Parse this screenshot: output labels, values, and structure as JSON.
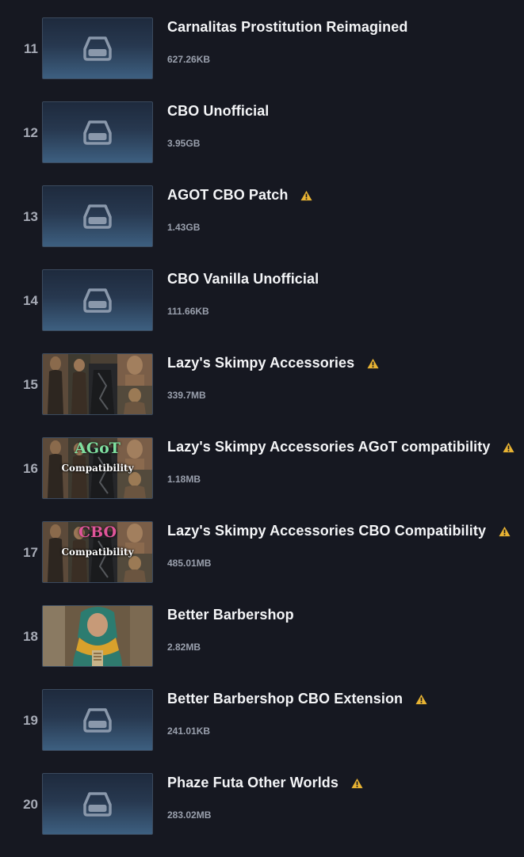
{
  "mods": [
    {
      "index": "11",
      "name": "Carnalitas Prostitution Reimagined",
      "size": "627.26KB",
      "warning": false,
      "thumbnail": "placeholder-drive-icon"
    },
    {
      "index": "12",
      "name": "CBO Unofficial",
      "size": "3.95GB",
      "warning": false,
      "thumbnail": "placeholder-drive-icon"
    },
    {
      "index": "13",
      "name": "AGOT CBO Patch",
      "size": "1.43GB",
      "warning": true,
      "thumbnail": "placeholder-drive-icon"
    },
    {
      "index": "14",
      "name": "CBO Vanilla Unofficial",
      "size": "111.66KB",
      "warning": false,
      "thumbnail": "placeholder-drive-icon"
    },
    {
      "index": "15",
      "name": "Lazy's Skimpy Accessories",
      "size": "339.7MB",
      "warning": true,
      "thumbnail": "armor-collage-image"
    },
    {
      "index": "16",
      "name": "Lazy's Skimpy Accessories AGoT compatibility",
      "size": "1.18MB",
      "warning": true,
      "thumbnail": "armor-collage-image",
      "thumb_text": [
        "AGoT",
        "Compatibility"
      ],
      "thumb_text_color": "#7fe0a0"
    },
    {
      "index": "17",
      "name": "Lazy's Skimpy Accessories CBO Compatibility",
      "size": "485.01MB",
      "warning": true,
      "thumbnail": "armor-collage-image",
      "thumb_text": [
        "CBO",
        "Compatibility"
      ],
      "thumb_text_color": "#e0559a"
    },
    {
      "index": "18",
      "name": "Better Barbershop",
      "size": "2.82MB",
      "warning": false,
      "thumbnail": "character-portrait-image"
    },
    {
      "index": "19",
      "name": "Better Barbershop CBO Extension",
      "size": "241.01KB",
      "warning": true,
      "thumbnail": "placeholder-drive-icon"
    },
    {
      "index": "20",
      "name": "Phaze Futa Other Worlds",
      "size": "283.02MB",
      "warning": true,
      "thumbnail": "placeholder-drive-icon"
    }
  ],
  "colors": {
    "background": "#161821",
    "warning": "#e8b333",
    "title": "#f4f5f7",
    "meta": "#9aa0ad"
  }
}
